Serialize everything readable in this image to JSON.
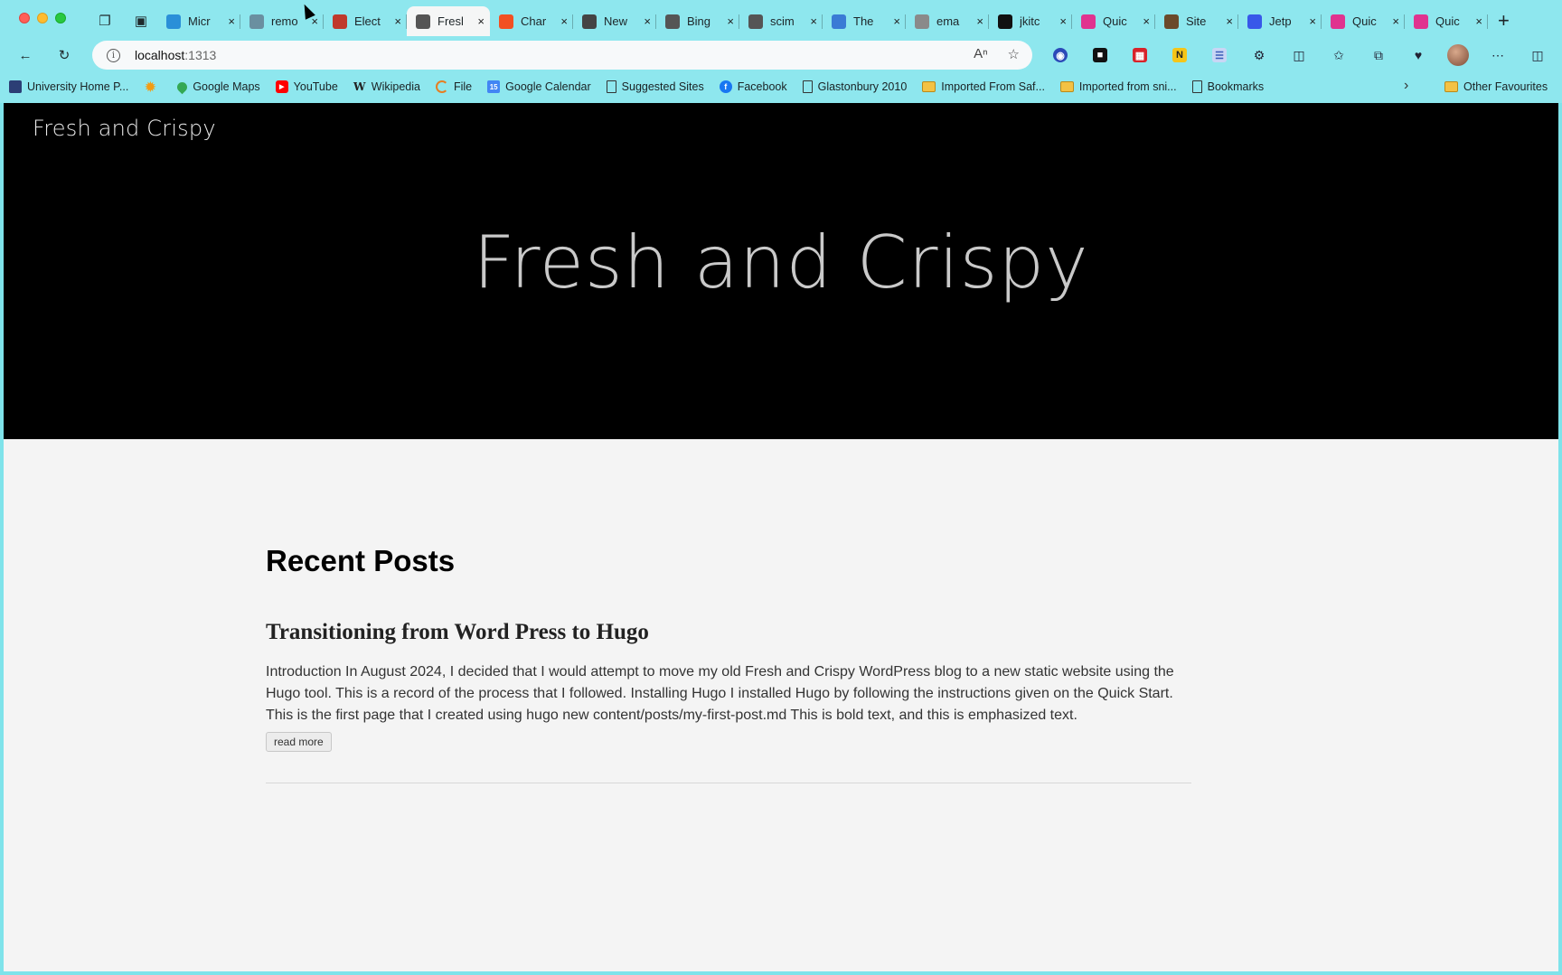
{
  "browser": {
    "tabs": [
      {
        "title": "Micr",
        "icon": "edge-icon",
        "color": "#2a8fd8"
      },
      {
        "title": "remo",
        "icon": "grid-icon",
        "color": "#6a8fa0"
      },
      {
        "title": "Elect",
        "icon": "youtube-icon",
        "color": "#c0392b"
      },
      {
        "title": "Fresl",
        "icon": "page-icon",
        "color": "#555555",
        "active": true
      },
      {
        "title": "Char",
        "icon": "microsoft-icon",
        "color": "#f25022"
      },
      {
        "title": "New",
        "icon": "calendar-icon",
        "color": "#444444"
      },
      {
        "title": "Bing",
        "icon": "search-icon",
        "color": "#555555"
      },
      {
        "title": "scim",
        "icon": "search-icon",
        "color": "#555555"
      },
      {
        "title": "The",
        "icon": "feather-icon",
        "color": "#3a7bd5"
      },
      {
        "title": "ema",
        "icon": "circle-icon",
        "color": "#8a8a8a"
      },
      {
        "title": "jkitc",
        "icon": "github-icon",
        "color": "#111111"
      },
      {
        "title": "Quic",
        "icon": "hugo-icon",
        "color": "#e0338f"
      },
      {
        "title": "Site",
        "icon": "image-icon",
        "color": "#6b4a2a"
      },
      {
        "title": "Jetp",
        "icon": "wordpress-icon",
        "color": "#3858e9"
      },
      {
        "title": "Quic",
        "icon": "hugo-icon",
        "color": "#e0338f"
      },
      {
        "title": "Quic",
        "icon": "hugo-icon",
        "color": "#e0338f"
      }
    ],
    "address": {
      "host": "localhost",
      "port": ":1313"
    },
    "bookmarks": [
      {
        "label": "University Home P...",
        "icon": "university-icon",
        "color": "#2c3e75"
      },
      {
        "label": "",
        "icon": "sun-icon",
        "color": "#f39c12"
      },
      {
        "label": "Google Maps",
        "icon": "maps-pin-icon",
        "color": "#34a853"
      },
      {
        "label": "YouTube",
        "icon": "youtube-icon",
        "color": "#ff0000"
      },
      {
        "label": "Wikipedia",
        "icon": "wikipedia-icon",
        "color": "#222222"
      },
      {
        "label": "File",
        "icon": "file-spinner-icon",
        "color": "#e67e22"
      },
      {
        "label": "Google Calendar",
        "icon": "calendar-icon",
        "color": "#4285f4"
      },
      {
        "label": "Suggested Sites",
        "icon": "doc-icon",
        "color": "#333333"
      },
      {
        "label": "Facebook",
        "icon": "facebook-icon",
        "color": "#1877f2"
      },
      {
        "label": "Glastonbury 2010",
        "icon": "doc-icon",
        "color": "#333333"
      },
      {
        "label": "Imported From Saf...",
        "icon": "folder-icon",
        "color": "#f3c244"
      },
      {
        "label": "Imported from sni...",
        "icon": "folder-icon",
        "color": "#f3c244"
      },
      {
        "label": "Bookmarks",
        "icon": "doc-icon",
        "color": "#333333"
      }
    ],
    "other_bookmarks": "Other Favourites"
  },
  "site": {
    "brand": "Fresh and Crispy",
    "hero_title": "Fresh and Crispy"
  },
  "main": {
    "section_title": "Recent Posts",
    "posts": [
      {
        "title": "Transitioning from Word Press to Hugo",
        "summary": "Introduction In August 2024, I decided that I would attempt to move my old Fresh and Crispy WordPress blog to a new static website using the Hugo tool. This is a record of the process that I followed. Installing Hugo I installed Hugo by following the instructions given on the Quick Start. This is the first page that I created using hugo new content/posts/my-first-post.md This is bold text, and this is emphasized text.",
        "read_more": "read more"
      }
    ]
  }
}
